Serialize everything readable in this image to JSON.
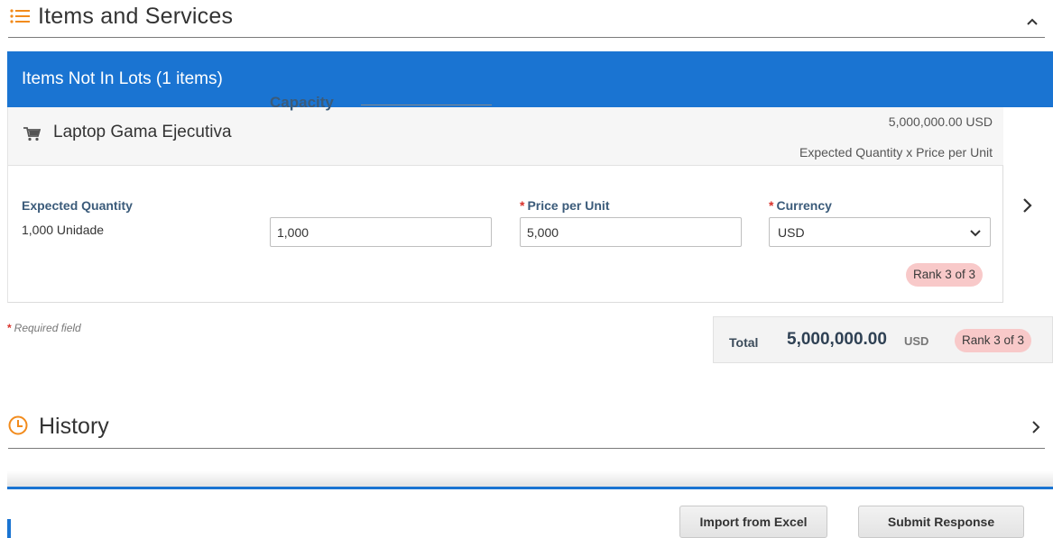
{
  "items_section": {
    "title": "Items and Services",
    "icon": "list-icon",
    "toggle_icon": "chevron-up-icon"
  },
  "lots_bar": {
    "label": "Items Not In Lots (1 items)",
    "color": "#1a74d2"
  },
  "item": {
    "icon": "cart-icon",
    "name": "Laptop Gama Ejecutiva",
    "total": "5,000,000.00 USD",
    "total_desc": "Expected Quantity x Price per Unit",
    "expected_quantity_label": "Expected Quantity",
    "expected_quantity_value": "1,000 Unidade",
    "capacity_label": "Capacity",
    "capacity_value": "1,000",
    "price_label": "Price per Unit",
    "price_value": "5,000",
    "currency_label": "Currency",
    "currency_value": "USD",
    "rank": "Rank 3 of 3",
    "required_marker": "*"
  },
  "required_note": {
    "marker": "*",
    "text": "Required field"
  },
  "total_box": {
    "label": "Total",
    "amount": "5,000,000.00",
    "currency": "USD",
    "rank": "Rank 3 of 3"
  },
  "history_section": {
    "title": "History",
    "icon": "clock-icon",
    "toggle_icon": "chevron-right-icon"
  },
  "footer": {
    "import_label": "Import from Excel",
    "submit_label": "Submit Response"
  },
  "colors": {
    "accent": "#1a74d2",
    "icon_orange": "#f28b1c",
    "required_red": "#d9322b",
    "rank_badge": "#f8c9c9"
  }
}
